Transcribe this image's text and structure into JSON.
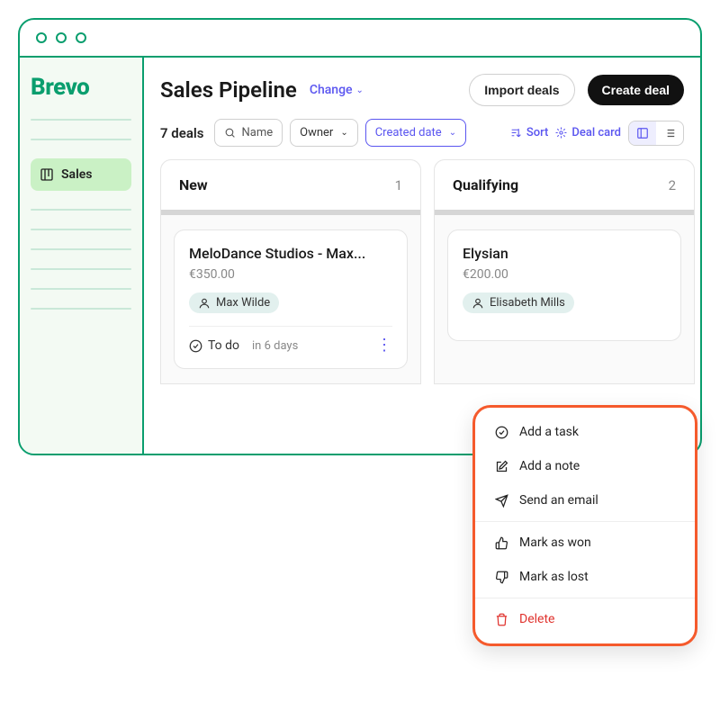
{
  "logo": "Brevo",
  "sidebar": {
    "active_label": "Sales"
  },
  "header": {
    "title": "Sales Pipeline",
    "change_label": "Change",
    "import_label": "Import deals",
    "create_label": "Create deal"
  },
  "toolbar": {
    "deal_count": "7 deals",
    "search_placeholder": "Name",
    "owner_label": "Owner",
    "created_label": "Created date",
    "sort_label": "Sort",
    "card_label": "Deal card"
  },
  "columns": [
    {
      "name": "New",
      "count": "1"
    },
    {
      "name": "Qualifying",
      "count": "2"
    }
  ],
  "deals": [
    {
      "name": "MeloDance Studios - Max...",
      "amount": "€350.00",
      "owner": "Max Wilde",
      "todo_label": "To do",
      "due": "in 6 days"
    },
    {
      "name": "Elysian",
      "amount": "€200.00",
      "owner": "Elisabeth Mills"
    }
  ],
  "menu": {
    "add_task": "Add a task",
    "add_note": "Add a note",
    "send_email": "Send an email",
    "mark_won": "Mark as won",
    "mark_lost": "Mark as lost",
    "delete": "Delete"
  }
}
